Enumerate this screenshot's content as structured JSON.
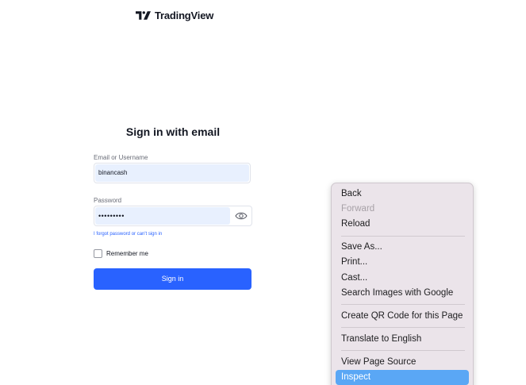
{
  "brand": {
    "name": "TradingView"
  },
  "form": {
    "title": "Sign in with email",
    "email_label": "Email or Username",
    "email_value": "binancash",
    "password_label": "Password",
    "password_value": "•••••••••",
    "forgot_link": "I forgot password or can't sign in",
    "remember_label": "Remember me",
    "remember_checked": false,
    "signin_label": "Sign in"
  },
  "context_menu": {
    "items": [
      {
        "label": "Back",
        "enabled": true
      },
      {
        "label": "Forward",
        "enabled": false
      },
      {
        "label": "Reload",
        "enabled": true
      },
      {
        "label": "Save As...",
        "enabled": true
      },
      {
        "label": "Print...",
        "enabled": true
      },
      {
        "label": "Cast...",
        "enabled": true
      },
      {
        "label": "Search Images with Google",
        "enabled": true
      },
      {
        "label": "Create QR Code for this Page",
        "enabled": true
      },
      {
        "label": "Translate to English",
        "enabled": true
      },
      {
        "label": "View Page Source",
        "enabled": true
      },
      {
        "label": "Inspect",
        "enabled": true,
        "highlighted": true
      }
    ]
  },
  "colors": {
    "accent": "#2962ff",
    "autofill": "#e8f0fe",
    "menu_bg": "#ebe4ea",
    "menu_highlight": "#5aa7f5"
  }
}
